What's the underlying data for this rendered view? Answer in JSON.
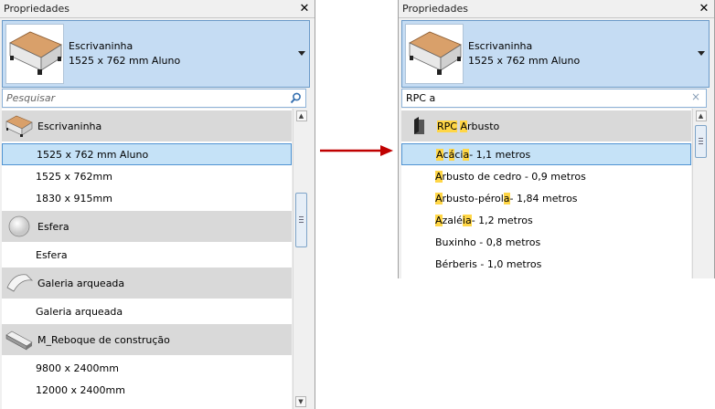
{
  "left": {
    "title": "Propriedades",
    "close_label": "✕",
    "type_name": "Escrivaninha",
    "type_size": "1525 x 762 mm Aluno",
    "search_placeholder": "Pesquisar",
    "search_value": "",
    "groups": [
      {
        "name": "Escrivaninha",
        "icon": "desk-icon",
        "items": [
          "1525 x 762 mm Aluno",
          "1525 x 762mm",
          "1830 x 915mm"
        ],
        "selected": 0
      },
      {
        "name": "Esfera",
        "icon": "sphere-icon",
        "items": [
          "Esfera"
        ],
        "selected": -1
      },
      {
        "name": "Galeria arqueada",
        "icon": "arched-gallery-icon",
        "items": [
          "Galeria arqueada"
        ],
        "selected": -1
      },
      {
        "name": "M_Reboque de construção",
        "icon": "trailer-icon",
        "items": [
          "9800 x 2400mm",
          "12000 x 2400mm"
        ],
        "selected": -1
      }
    ]
  },
  "right": {
    "title": "Propriedades",
    "close_label": "✕",
    "type_name": "Escrivaninha",
    "type_size": "1525 x 762 mm Aluno",
    "search_value": "RPC a",
    "clear_label": "×",
    "group": {
      "icon": "rpc-shrub-icon",
      "name_parts": [
        {
          "text": "RPC",
          "hl": true
        },
        {
          "text": " ",
          "hl": false
        },
        {
          "text": "A",
          "hl": true
        },
        {
          "text": "rbusto",
          "hl": false
        }
      ]
    },
    "items": [
      {
        "parts": [
          {
            "text": "A",
            "hl": true
          },
          {
            "text": "c",
            "hl": false
          },
          {
            "text": "á",
            "hl": true
          },
          {
            "text": "ci",
            "hl": false
          },
          {
            "text": "a",
            "hl": true
          },
          {
            "text": " - 1,1 metros",
            "hl": false
          }
        ],
        "selected": true
      },
      {
        "parts": [
          {
            "text": "A",
            "hl": true
          },
          {
            "text": "rbusto de cedro - 0,9 metros",
            "hl": false
          }
        ],
        "selected": false
      },
      {
        "parts": [
          {
            "text": "A",
            "hl": true
          },
          {
            "text": "rbusto-pérol",
            "hl": false
          },
          {
            "text": "a",
            "hl": true
          },
          {
            "text": " - 1,84 metros",
            "hl": false
          }
        ],
        "selected": false
      },
      {
        "parts": [
          {
            "text": "A",
            "hl": true
          },
          {
            "text": "zalé",
            "hl": false
          },
          {
            "text": "i",
            "hl": true
          },
          {
            "text": "a",
            "hl": true
          },
          {
            "text": " - 1,2 metros",
            "hl": false
          }
        ],
        "selected": false
      },
      {
        "parts": [
          {
            "text": "Buxinho - 0,8 metros",
            "hl": false
          }
        ],
        "selected": false
      },
      {
        "parts": [
          {
            "text": "Bérberis - 1,0 metros",
            "hl": false
          }
        ],
        "selected": false
      }
    ]
  },
  "colors": {
    "accent": "#c5dcf3",
    "highlight": "#ffd646",
    "arrow": "#c00000",
    "header_row": "#d9d9d9"
  }
}
